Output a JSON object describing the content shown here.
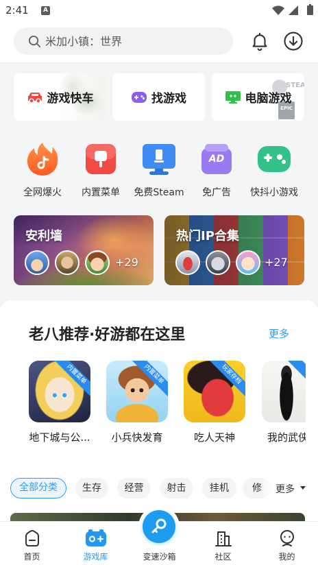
{
  "status_bar": {
    "time": "2:41",
    "notification_badge": "A",
    "icons": [
      "wifi-icon",
      "signal-icon",
      "battery-icon"
    ]
  },
  "header": {
    "search_placeholder": "米加小镇：世界",
    "search_icon": "search-icon",
    "bell_icon": "bell-icon",
    "download_icon": "download-icon"
  },
  "quick_cards": [
    {
      "label": "游戏快车",
      "icon": "car-icon",
      "color": "#f2453d"
    },
    {
      "label": "找游戏",
      "icon": "gamepad-icon",
      "color": "#8b5cf6"
    },
    {
      "label": "电脑游戏",
      "icon": "monitor-icon",
      "color": "#2fbf4a",
      "logos": [
        "STEAM",
        "EPIC"
      ]
    }
  ],
  "features": [
    {
      "label": "全网爆火",
      "icon": "flame-icon"
    },
    {
      "label": "内置菜单",
      "icon": "menu-icon"
    },
    {
      "label": "免费Steam",
      "icon": "monitor-icon"
    },
    {
      "label": "免广告",
      "icon": "no-ads-icon",
      "icon_text": "AD"
    },
    {
      "label": "快抖小游戏",
      "icon": "gamepad-icon"
    }
  ],
  "banners": [
    {
      "title": "安利墙",
      "extra_count": "+29"
    },
    {
      "title": "热门IP合集",
      "extra_count": "+27"
    }
  ],
  "recommend": {
    "title": "老八推荐·好游都在这里",
    "more": "更多",
    "games": [
      {
        "name": "地下城与公...",
        "badge": "内置菜单"
      },
      {
        "name": "小兵快发育",
        "badge": "内置菜单"
      },
      {
        "name": "吃人天神",
        "badge": "玩家存档"
      },
      {
        "name": "我的武侠",
        "badge": ""
      }
    ]
  },
  "categories": {
    "chips": [
      "全部分类",
      "生存",
      "经营",
      "射击",
      "挂机",
      "修"
    ],
    "selected": "全部分类",
    "more": "更多"
  },
  "bottom_nav": {
    "items": [
      {
        "label": "首页",
        "icon": "home-icon"
      },
      {
        "label": "游戏库",
        "icon": "game-library-icon"
      },
      {
        "label": "变速沙箱",
        "icon": "key-icon"
      },
      {
        "label": "社区",
        "icon": "community-icon"
      },
      {
        "label": "我的",
        "icon": "profile-icon"
      }
    ],
    "selected": "游戏库"
  },
  "colors": {
    "accent": "#2a9df4",
    "nav_selected": "#2196f3",
    "text": "#222222",
    "background": "#f4f5f7"
  }
}
